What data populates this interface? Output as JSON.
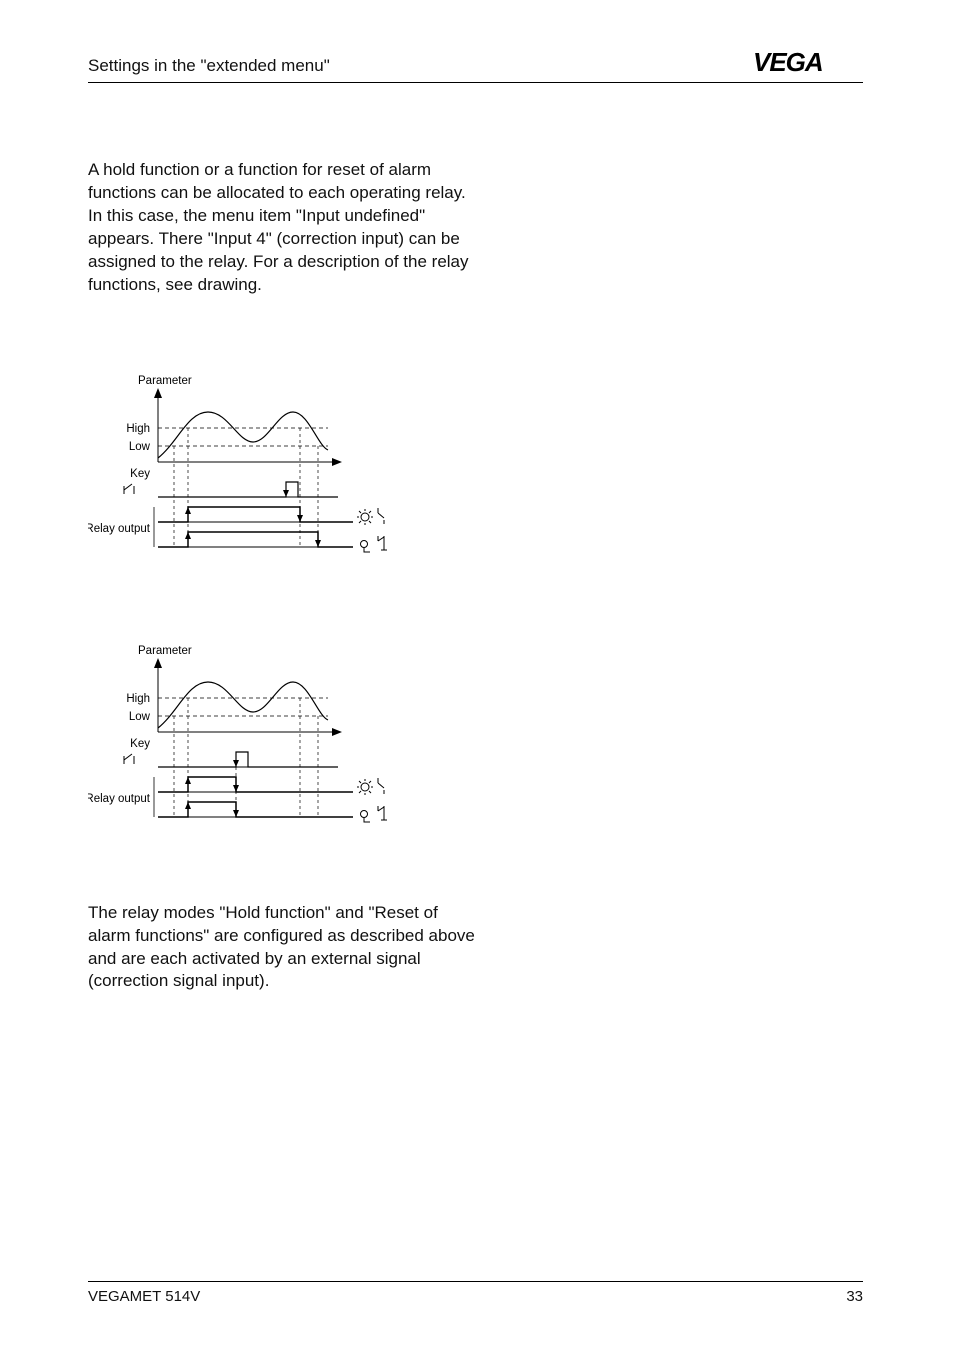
{
  "header": {
    "section_title": "Settings in the \"extended menu\"",
    "logo_text": "VEGA"
  },
  "paragraphs": {
    "p1": "A hold function or a function for reset of alarm functions can be allocated to each operating relay. In this case, the menu item \"Input undefined\" appears. There \"Input 4\" (correction input) can be assigned to the relay. For a description of the relay functions, see drawing.",
    "p2": "The relay modes \"Hold function\" and \"Reset of alarm functions\" are configured as described above and are each activated by an external signal (correction signal input)."
  },
  "diagram": {
    "y_title": "Parameter",
    "y_high": "High",
    "y_low": "Low",
    "y_key": "Key",
    "y_relay": "Relay output"
  },
  "footer": {
    "product": "VEGAMET 514V",
    "page": "33"
  }
}
